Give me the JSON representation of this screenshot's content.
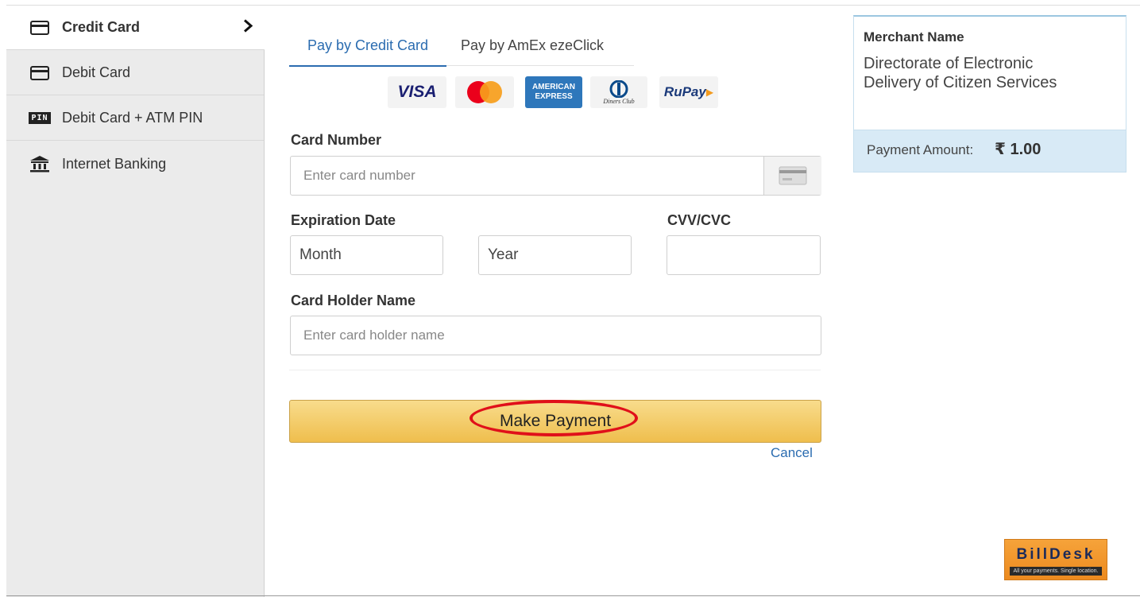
{
  "sidebar": {
    "items": [
      {
        "label": "Credit Card",
        "icon": "credit-card-icon",
        "active": true
      },
      {
        "label": "Debit Card",
        "icon": "debit-card-icon",
        "active": false
      },
      {
        "label": "Debit Card + ATM PIN",
        "icon": "pin-icon",
        "active": false
      },
      {
        "label": "Internet Banking",
        "icon": "bank-icon",
        "active": false
      }
    ],
    "pin_badge": "PIN",
    "chevron": "›"
  },
  "tabs": [
    {
      "label": "Pay by Credit Card",
      "active": true
    },
    {
      "label": "Pay by AmEx ezeClick",
      "active": false
    }
  ],
  "card_logos": {
    "visa": "VISA",
    "amex_line1": "AMERICAN",
    "amex_line2": "EXPRESS",
    "diners": "Diners Club",
    "rupay": "RuPay"
  },
  "form": {
    "card_number_label": "Card Number",
    "card_number_placeholder": "Enter card number",
    "expiration_label": "Expiration Date",
    "month": "Month",
    "year": "Year",
    "cvv_label": "CVV/CVC",
    "holder_label": "Card Holder Name",
    "holder_placeholder": "Enter card holder name"
  },
  "actions": {
    "make_payment": "Make Payment",
    "cancel": "Cancel"
  },
  "merchant": {
    "title": "Merchant Name",
    "name_line1": "Directorate of Electronic",
    "name_line2": "Delivery of Citizen Services",
    "amount_label": "Payment Amount:",
    "amount_value": "₹ 1.00"
  },
  "branding": {
    "name": "BillDesk",
    "tagline": "All your payments. Single location."
  },
  "colors": {
    "accent": "#2b6cb0",
    "button_top": "#f8dc8c",
    "button_bottom": "#efbe4d",
    "highlight_ring": "#e0101a",
    "amount_bar": "#d8eaf6",
    "sidebar_bg": "#ebebeb"
  }
}
